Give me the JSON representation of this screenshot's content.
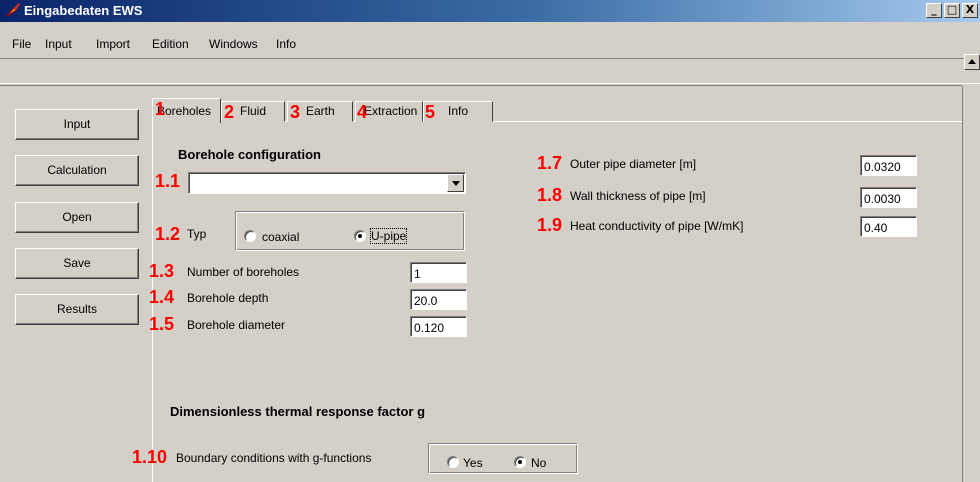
{
  "window": {
    "title": "Eingabedaten EWS",
    "minimize": "_",
    "maximize": "□",
    "close": "X"
  },
  "menu": [
    "File",
    "Input",
    "Import",
    "Edition",
    "Windows",
    "Info"
  ],
  "left_buttons": [
    "Input",
    "Calculation",
    "Open",
    "Save",
    "Results"
  ],
  "tabs": [
    {
      "marker": "1",
      "label": "Boreholes"
    },
    {
      "marker": "2",
      "label": "Fluid"
    },
    {
      "marker": "3",
      "label": "Earth"
    },
    {
      "marker": "4",
      "label": "Extraction"
    },
    {
      "marker": "5",
      "label": "Info"
    }
  ],
  "borehole": {
    "section_title": "Borehole configuration",
    "config_marker": "1.1",
    "config_value": "",
    "typ_marker": "1.2",
    "typ_label": "Typ",
    "typ_options": [
      "coaxial",
      "U-pipe"
    ],
    "typ_selected": "U-pipe",
    "count_marker": "1.3",
    "count_label": "Number of boreholes",
    "count_value": "1",
    "depth_marker": "1.4",
    "depth_label": "Borehole depth",
    "depth_value": "20.0",
    "diameter_marker": "1.5",
    "diameter_label": "Borehole diameter",
    "diameter_value": "0.120"
  },
  "pipe": {
    "outer_marker": "1.7",
    "outer_label": "Outer pipe diameter [m]",
    "outer_value": "0.0320",
    "wall_marker": "1.8",
    "wall_label": "Wall thickness of pipe [m]",
    "wall_value": "0.0030",
    "cond_marker": "1.9",
    "cond_label": "Heat conductivity of pipe [W/mK]",
    "cond_value": "0.40"
  },
  "gfactor": {
    "section_title": "Dimensionless thermal response factor g",
    "bc_marker": "1.10",
    "bc_label": "Boundary conditions with g-functions",
    "options": [
      "Yes",
      "No"
    ],
    "selected": "No"
  },
  "colors": {
    "marker": "#ff0000",
    "titlebar_start": "#0a246a",
    "face": "#d4d0c8"
  }
}
